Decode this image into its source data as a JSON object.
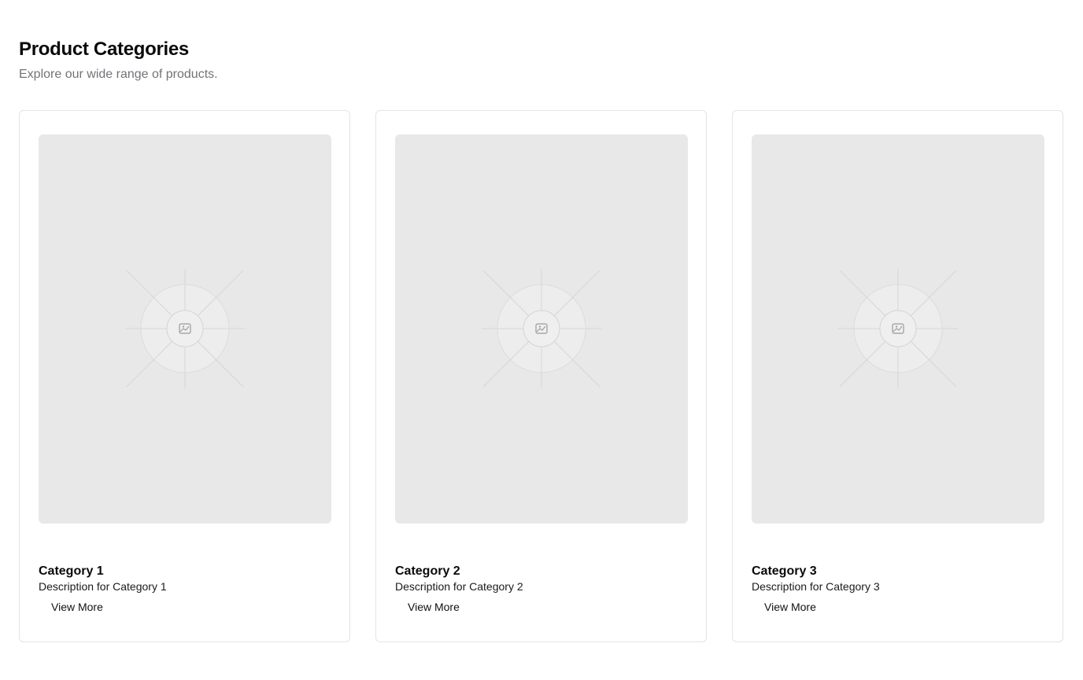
{
  "header": {
    "title": "Product Categories",
    "subtitle": "Explore our wide range of products."
  },
  "categories": [
    {
      "title": "Category 1",
      "description": "Description for Category 1",
      "button_label": "View More",
      "image_icon": "image-placeholder-icon"
    },
    {
      "title": "Category 2",
      "description": "Description for Category 2",
      "button_label": "View More",
      "image_icon": "image-placeholder-icon"
    },
    {
      "title": "Category 3",
      "description": "Description for Category 3",
      "button_label": "View More",
      "image_icon": "image-placeholder-icon"
    }
  ],
  "colors": {
    "placeholder_bg": "#e8e8e8",
    "card_border": "#e4e4e7",
    "subtitle_text": "#737378"
  }
}
